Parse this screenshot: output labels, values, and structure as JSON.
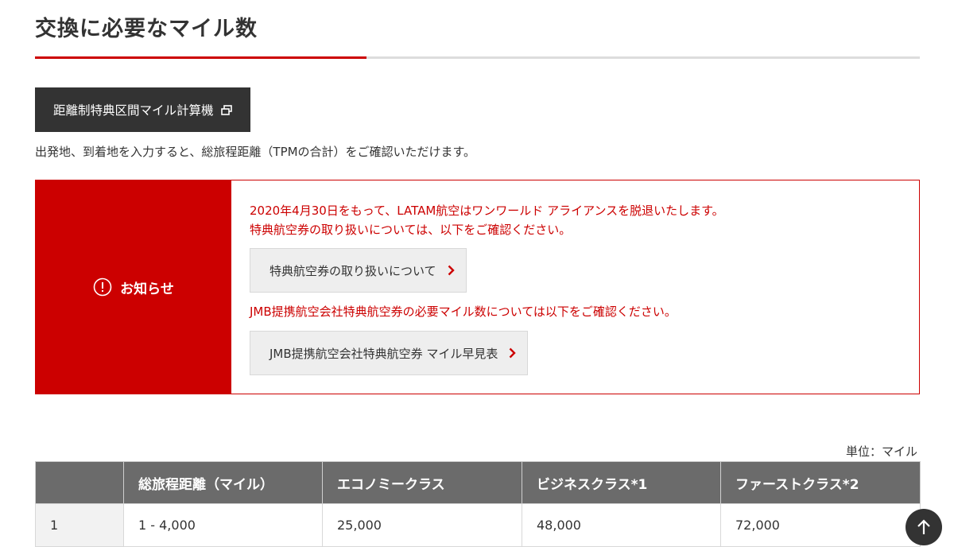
{
  "page": {
    "title": "交換に必要なマイル数"
  },
  "calculator": {
    "button_label": "距離制特典区間マイル計算機",
    "icon": "external-window-icon",
    "description": "出発地、到着地を入力すると、総旅程距離（TPMの合計）をご確認いただけます。"
  },
  "notice": {
    "label": "お知らせ",
    "icon": "alert-circle-icon",
    "line1": "2020年4月30日をもって、LATAM航空はワンワールド アライアンスを脱退いたします。",
    "line2": "特典航空券の取り扱いについては、以下をご確認ください。",
    "button1_label": "特典航空券の取り扱いについて",
    "line3": "JMB提携航空会社特典航空券の必要マイル数については以下をご確認ください。",
    "button2_label": "JMB提携航空会社特典航空券 マイル早見表"
  },
  "table": {
    "unit_label": "単位：マイル",
    "headers": [
      "",
      "総旅程距離（マイル）",
      "エコノミークラス",
      "ビジネスクラス*1",
      "ファーストクラス*2"
    ],
    "rows": [
      [
        "1",
        "1 - 4,000",
        "25,000",
        "48,000",
        "72,000"
      ]
    ]
  },
  "colors": {
    "accent_red": "#cc0000",
    "dark_button": "#333333",
    "table_header": "#6b6b6b"
  },
  "scroll_top": {
    "icon": "arrow-up-icon"
  }
}
